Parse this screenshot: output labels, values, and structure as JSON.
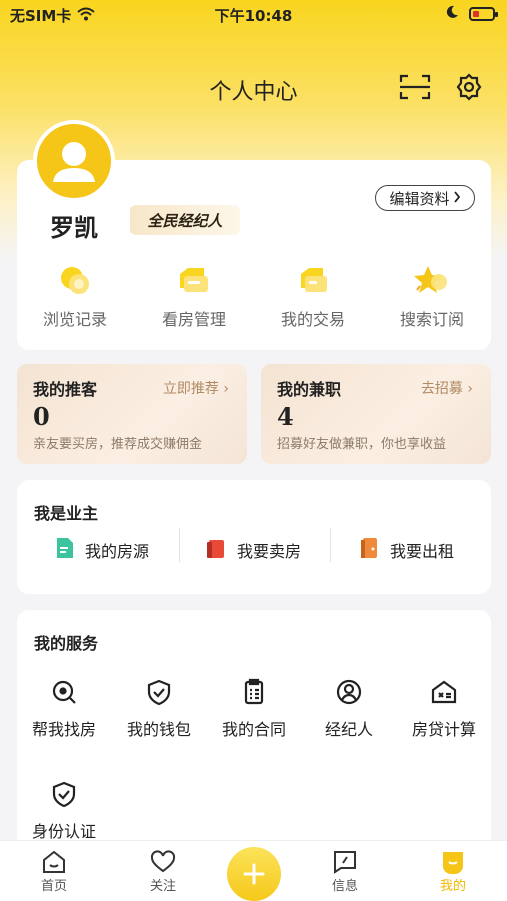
{
  "status_bar": {
    "carrier": "无SIM卡",
    "time": "下午10:48"
  },
  "header": {
    "title": "个人中心"
  },
  "profile": {
    "name": "罗凯",
    "tag": "全民经纪人",
    "edit_label": "编辑资料"
  },
  "quick_actions": [
    {
      "label": "浏览记录",
      "icon": "history-icon"
    },
    {
      "label": "看房管理",
      "icon": "viewing-manage-icon"
    },
    {
      "label": "我的交易",
      "icon": "transaction-icon"
    },
    {
      "label": "搜索订阅",
      "icon": "subscribe-star-icon"
    }
  ],
  "promos": [
    {
      "title": "我的推客",
      "link": "立即推荐",
      "value": "0",
      "subtitle": "亲友要买房，推荐成交赚佣金"
    },
    {
      "title": "我的兼职",
      "link": "去招募",
      "value": "4",
      "subtitle": "招募好友做兼职，你也享收益"
    }
  ],
  "owner": {
    "title": "我是业主",
    "items": [
      {
        "label": "我的房源",
        "icon": "listing-doc-icon",
        "color": "#3cc3a0"
      },
      {
        "label": "我要卖房",
        "icon": "sell-house-icon",
        "color": "#e84a3a"
      },
      {
        "label": "我要出租",
        "icon": "rent-door-icon",
        "color": "#f08a3a"
      }
    ]
  },
  "services": {
    "title": "我的服务",
    "items": [
      {
        "label": "帮我找房",
        "icon": "find-house-icon"
      },
      {
        "label": "我的钱包",
        "icon": "wallet-shield-icon"
      },
      {
        "label": "我的合同",
        "icon": "contract-icon"
      },
      {
        "label": "经纪人",
        "icon": "agent-icon"
      },
      {
        "label": "房贷计算",
        "icon": "mortgage-calc-icon"
      },
      {
        "label": "身份认证",
        "icon": "id-verify-icon"
      }
    ]
  },
  "tabbar": {
    "items": [
      {
        "label": "首页",
        "icon": "home-icon"
      },
      {
        "label": "关注",
        "icon": "heart-icon"
      },
      {
        "label": "信息",
        "icon": "message-icon"
      },
      {
        "label": "我的",
        "icon": "profile-icon",
        "active": true
      }
    ],
    "active_color": "#f5c518"
  },
  "colors": {
    "brand": "#f9d51f",
    "promo_link": "#b08a62"
  }
}
